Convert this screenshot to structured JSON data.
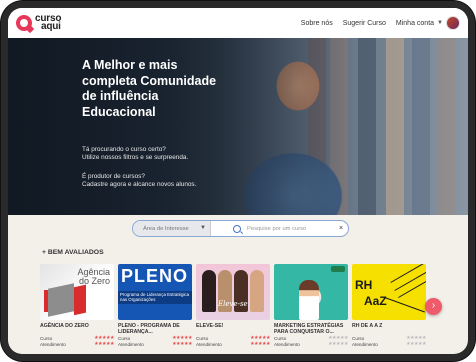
{
  "header": {
    "logo_line1": "curso",
    "logo_line2": "aqui",
    "nav": [
      "Sobre nós",
      "Sugerir Curso",
      "Minha conta"
    ]
  },
  "hero": {
    "title": "A Melhor e mais completa Comunidade de influência Educacional",
    "line1a": "Tá procurando o curso certo?",
    "line1b": "Utilize nossos filtros e se surpreenda.",
    "line2a": "É produtor de cursos?",
    "line2b": "Cadastre agora e alcance novos alunos."
  },
  "search": {
    "area_placeholder": "Área de Interesse",
    "query_placeholder": "Pesquise por um curso",
    "clear": "×"
  },
  "section": {
    "title": "+ BEM AVALIADOS"
  },
  "rating_labels": {
    "curso": "Curso",
    "atendimento": "Atendimento"
  },
  "courses": [
    {
      "title": "AGÊNCIA DO ZERO",
      "thumb_text": "Agência do Zero",
      "curso_stars": 5,
      "atendimento_stars": 5
    },
    {
      "title": "PLENO - PROGRAMA DE LIDERANÇA...",
      "thumb_big": "PLENO",
      "thumb_small": "Programa de Liderança Estratégica nas Organizações",
      "curso_stars": 5,
      "atendimento_stars": 5
    },
    {
      "title": "ELEVE-SE!",
      "thumb_text": "Eleve-se",
      "curso_stars": 5,
      "atendimento_stars": 5
    },
    {
      "title": "MARKETING ESTRATÉGIAS PARA CONQUISTAR O...",
      "curso_stars": 0,
      "atendimento_stars": 0
    },
    {
      "title": "RH DE A A Z",
      "thumb_rh": "RH",
      "thumb_az": "AaZ",
      "curso_stars": 0,
      "atendimento_stars": 0
    }
  ],
  "colors": {
    "brand": "#e8385a",
    "stars": "#e25050",
    "search_border": "#8aa7d6"
  },
  "icons": {
    "next": "chevron-right-icon",
    "search": "search-icon"
  },
  "next_glyph": "›"
}
